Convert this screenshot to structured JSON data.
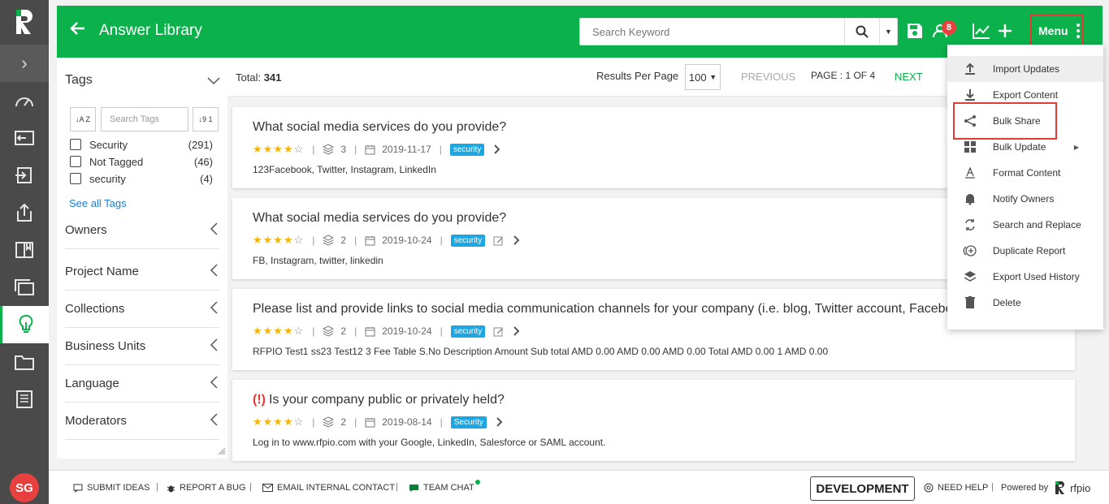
{
  "header": {
    "title": "Answer Library",
    "search_placeholder": "Search Keyword",
    "notification_count": "8",
    "menu_label": "Menu"
  },
  "sidebar": {
    "avatar_initials": "SG",
    "items": [
      "dashboard-icon",
      "inbox-icon",
      "import-icon",
      "export-icon",
      "book-icon",
      "projects-icon",
      "lightbulb-icon",
      "folder-icon",
      "document-icon"
    ]
  },
  "filters": {
    "tags_heading": "Tags",
    "tag_search_placeholder": "Search Tags",
    "sort_az_label": "↓A Z",
    "sort_num_label": "↓9 1",
    "tags": [
      {
        "label": "Security",
        "count": "(291)"
      },
      {
        "label": "Not Tagged",
        "count": "(46)"
      },
      {
        "label": "security",
        "count": "(4)"
      }
    ],
    "see_all": "See all Tags",
    "sections": [
      "Owners",
      "Project Name",
      "Collections",
      "Business Units",
      "Language",
      "Moderators"
    ]
  },
  "results": {
    "total_label": "Total:",
    "total_value": "341",
    "results_per_page_label": "Results Per Page",
    "results_per_page_value": "100",
    "previous_label": "PREVIOUS",
    "page_label": "PAGE : 1 OF 4",
    "next_label": "NEXT",
    "items": [
      {
        "question": "What social media services do you provide?",
        "rating": 4,
        "versions": "3",
        "date": "2019-11-17",
        "tag": "security",
        "answer": "123Facebook, Twitter, Instagram, LinkedIn",
        "alert": "",
        "editable": false
      },
      {
        "question": "What social media services do you provide?",
        "rating": 4,
        "versions": "2",
        "date": "2019-10-24",
        "tag": "security",
        "answer": "FB, Instagram, twitter, linkedin",
        "alert": "",
        "editable": true
      },
      {
        "question": "Please list and provide links to social media communication channels for your company (i.e. blog, Twitter account, Facebook page)",
        "rating": 4,
        "versions": "2",
        "date": "2019-10-24",
        "tag": "security",
        "answer": "RFPIO Test1 ss23 Test12 3 Fee Table S.No Description Amount Sub total AMD 0.00 AMD 0.00 AMD 0.00 Total AMD 0.00 1 AMD 0.00",
        "alert": "",
        "editable": true
      },
      {
        "question": "Is your company public or privately held?",
        "rating": 4,
        "versions": "2",
        "date": "2019-08-14",
        "tag": "Security",
        "answer": "Log in to www.rfpio.com with your Google, LinkedIn, Salesforce or SAML account.",
        "alert": "(!)",
        "editable": false
      }
    ]
  },
  "menu": {
    "items": [
      {
        "label": "Import Updates",
        "icon": "upload-icon"
      },
      {
        "label": "Export Content",
        "icon": "download-icon"
      },
      {
        "label": "Bulk Share",
        "icon": "share-icon"
      },
      {
        "label": "Bulk Update",
        "icon": "grid-icon"
      },
      {
        "label": "Format Content",
        "icon": "format-icon"
      },
      {
        "label": "Notify Owners",
        "icon": "bell-icon"
      },
      {
        "label": "Search and Replace",
        "icon": "replace-icon"
      },
      {
        "label": "Duplicate Report",
        "icon": "duplicate-icon"
      },
      {
        "label": "Export Used History",
        "icon": "layers-icon"
      },
      {
        "label": "Delete",
        "icon": "trash-icon"
      }
    ]
  },
  "footer": {
    "submit_ideas": "SUBMIT IDEAS",
    "report_bug": "REPORT A BUG",
    "email_contact": "EMAIL INTERNAL CONTACT",
    "team_chat": "TEAM CHAT",
    "environment": "DEVELOPMENT",
    "need_help": "NEED HELP",
    "powered_by": "Powered by",
    "brand": "rfpio"
  },
  "colors": {
    "brand_green": "#0bb14b",
    "highlight_red": "#e53935",
    "tag_blue": "#1aa7e3",
    "star_yellow": "#f5b400"
  }
}
